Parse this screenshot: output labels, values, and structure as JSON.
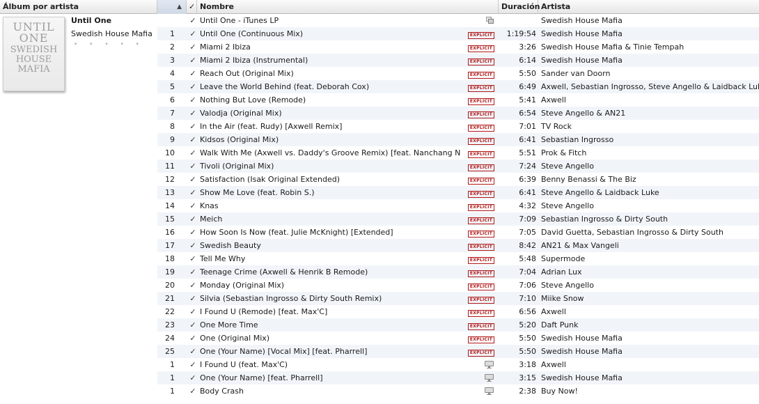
{
  "columns": {
    "album": "Álbum por artista",
    "check": "✓",
    "name": "Nombre",
    "duration": "Duración",
    "artist": "Artista",
    "sort_indicator": "▲"
  },
  "album": {
    "title": "Until One",
    "artist": "Swedish House Mafia",
    "rating": "• • • • •",
    "art_lines": [
      "UNTIL",
      "ONE",
      "SWEDISH",
      "HOUSE",
      "MAFIA"
    ]
  },
  "explicit_label": "EXPLICIT",
  "tracks": [
    {
      "num": "",
      "name": "Until One - iTunes LP",
      "badge": "lp",
      "duration": "",
      "artist": "Swedish House Mafia"
    },
    {
      "num": "1",
      "name": "Until One (Continuous Mix)",
      "badge": "explicit",
      "duration": "1:19:54",
      "artist": "Swedish House Mafia"
    },
    {
      "num": "2",
      "name": "Miami 2 Ibiza",
      "badge": "explicit",
      "duration": "3:26",
      "artist": "Swedish House Mafia & Tinie Tempah"
    },
    {
      "num": "3",
      "name": "Miami 2 Ibiza (Instrumental)",
      "badge": "explicit",
      "duration": "6:14",
      "artist": "Swedish House Mafia"
    },
    {
      "num": "4",
      "name": "Reach Out (Original Mix)",
      "badge": "explicit",
      "duration": "5:50",
      "artist": "Sander van Doorn"
    },
    {
      "num": "5",
      "name": "Leave the World Behind (feat. Deborah Cox)",
      "badge": "explicit",
      "duration": "6:49",
      "artist": "Axwell, Sebastian Ingrosso, Steve Angello & Laidback Luke"
    },
    {
      "num": "6",
      "name": "Nothing But Love (Remode)",
      "badge": "explicit",
      "duration": "5:41",
      "artist": "Axwell"
    },
    {
      "num": "7",
      "name": "Valodja (Original Mix)",
      "badge": "explicit",
      "duration": "6:54",
      "artist": "Steve Angello & AN21"
    },
    {
      "num": "8",
      "name": "In the Air (feat. Rudy) [Axwell Remix]",
      "badge": "explicit",
      "duration": "7:01",
      "artist": "TV Rock"
    },
    {
      "num": "9",
      "name": "Kidsos (Original Mix)",
      "badge": "explicit",
      "duration": "6:41",
      "artist": "Sebastian Ingrosso"
    },
    {
      "num": "10",
      "name": "Walk With Me (Axwell vs. Daddy's Groove Remix) [feat. Nanchang Nancy]",
      "badge": "explicit",
      "duration": "5:51",
      "artist": "Prok & Fitch"
    },
    {
      "num": "11",
      "name": "Tivoli (Original Mix)",
      "badge": "explicit",
      "duration": "7:24",
      "artist": "Steve Angello"
    },
    {
      "num": "12",
      "name": "Satisfaction (Isak Original Extended)",
      "badge": "explicit",
      "duration": "6:39",
      "artist": "Benny Benassi & The Biz"
    },
    {
      "num": "13",
      "name": "Show Me Love (feat. Robin S.)",
      "badge": "explicit",
      "duration": "6:41",
      "artist": "Steve Angello & Laidback Luke"
    },
    {
      "num": "14",
      "name": "Knas",
      "badge": "explicit",
      "duration": "4:32",
      "artist": "Steve Angello"
    },
    {
      "num": "15",
      "name": "Meich",
      "badge": "explicit",
      "duration": "7:09",
      "artist": "Sebastian Ingrosso & Dirty South"
    },
    {
      "num": "16",
      "name": "How Soon Is Now (feat. Julie McKnight) [Extended]",
      "badge": "explicit",
      "duration": "7:05",
      "artist": "David Guetta, Sebastian Ingrosso & Dirty South"
    },
    {
      "num": "17",
      "name": "Swedish Beauty",
      "badge": "explicit",
      "duration": "8:42",
      "artist": "AN21 & Max Vangeli"
    },
    {
      "num": "18",
      "name": "Tell Me Why",
      "badge": "explicit",
      "duration": "5:48",
      "artist": "Supermode"
    },
    {
      "num": "19",
      "name": "Teenage Crime (Axwell & Henrik B Remode)",
      "badge": "explicit",
      "duration": "7:04",
      "artist": "Adrian Lux"
    },
    {
      "num": "20",
      "name": "Monday (Original Mix)",
      "badge": "explicit",
      "duration": "7:06",
      "artist": "Steve Angello"
    },
    {
      "num": "21",
      "name": "Silvia (Sebastian Ingrosso & Dirty South Remix)",
      "badge": "explicit",
      "duration": "7:10",
      "artist": "Miike Snow"
    },
    {
      "num": "22",
      "name": "I Found U (Remode) [feat. Max'C]",
      "badge": "explicit",
      "duration": "6:56",
      "artist": "Axwell"
    },
    {
      "num": "23",
      "name": "One More Time",
      "badge": "explicit",
      "duration": "5:20",
      "artist": "Daft Punk"
    },
    {
      "num": "24",
      "name": "One (Original Mix)",
      "badge": "explicit",
      "duration": "5:50",
      "artist": "Swedish House Mafia"
    },
    {
      "num": "25",
      "name": "One (Your Name) [Vocal Mix] [feat. Pharrell]",
      "badge": "explicit",
      "duration": "5:50",
      "artist": "Swedish House Mafia"
    },
    {
      "num": "1",
      "name": "I Found U (feat. Max'C)",
      "badge": "video",
      "duration": "3:18",
      "artist": "Axwell"
    },
    {
      "num": "1",
      "name": "One (Your Name) [feat. Pharrell]",
      "badge": "video",
      "duration": "3:15",
      "artist": "Swedish House Mafia"
    },
    {
      "num": "1",
      "name": "Body Crash",
      "badge": "video",
      "duration": "2:38",
      "artist": "Buy Now!"
    }
  ]
}
